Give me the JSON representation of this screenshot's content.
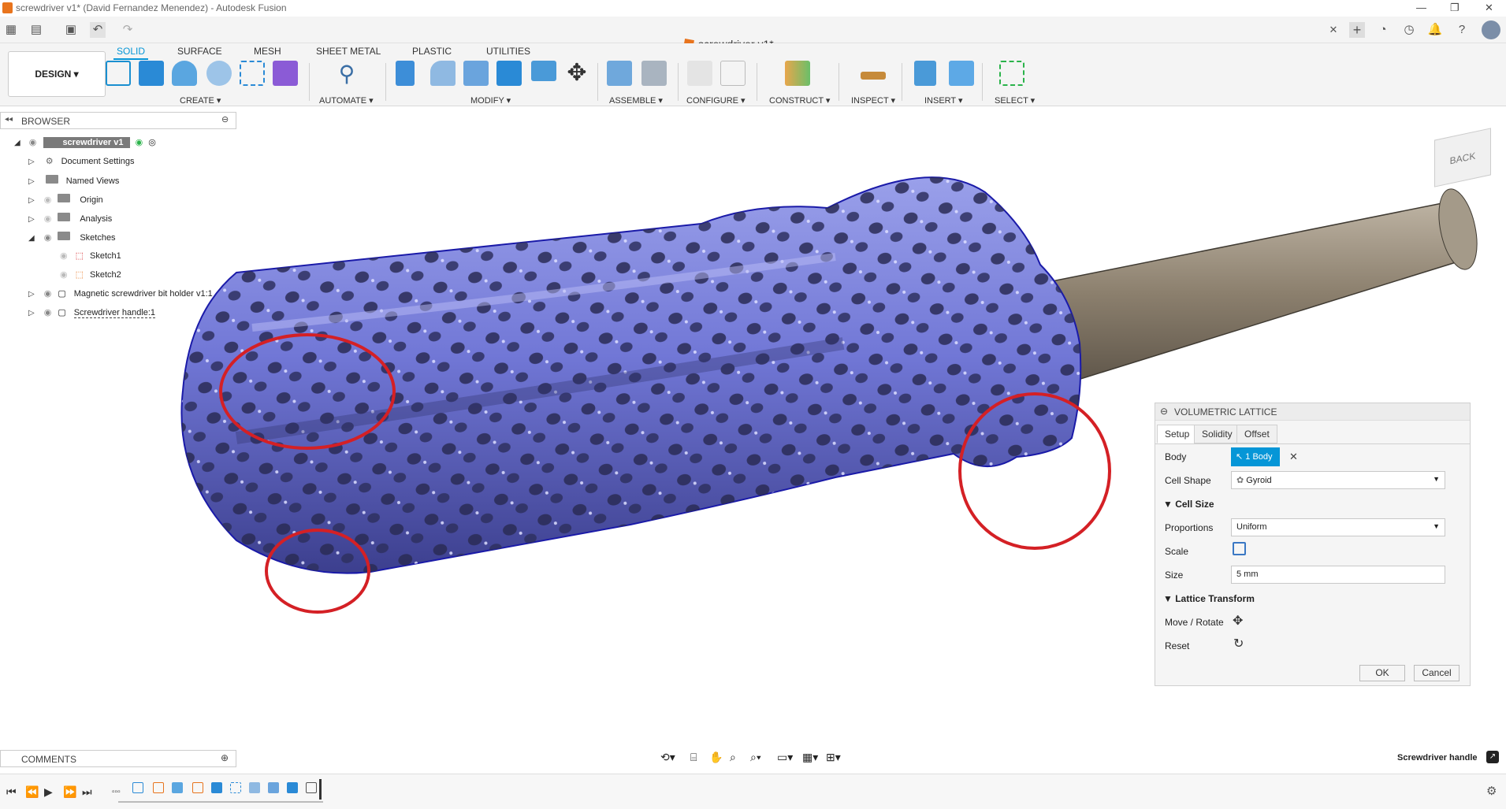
{
  "window": {
    "title": "screwdriver v1* (David Fernandez Menendez) - Autodesk Fusion",
    "document_tab": "screwdriver v1*"
  },
  "ribbon": {
    "workspace": "DESIGN",
    "tabs": [
      {
        "label": "SOLID",
        "active": true
      },
      {
        "label": "SURFACE"
      },
      {
        "label": "MESH"
      },
      {
        "label": "SHEET METAL"
      },
      {
        "label": "PLASTIC"
      },
      {
        "label": "UTILITIES"
      }
    ],
    "groups": [
      "CREATE",
      "AUTOMATE",
      "MODIFY",
      "ASSEMBLE",
      "CONFIGURE",
      "CONSTRUCT",
      "INSPECT",
      "INSERT",
      "SELECT"
    ]
  },
  "browser": {
    "title": "BROWSER",
    "root": "screwdriver v1",
    "items": [
      "Document Settings",
      "Named Views",
      "Origin",
      "Analysis",
      "Sketches",
      "Sketch1",
      "Sketch2",
      "Magnetic screwdriver bit holder v1:1",
      "Screwdriver handle:1"
    ]
  },
  "panel": {
    "title": "VOLUMETRIC LATTICE",
    "tabs": [
      "Setup",
      "Solidity",
      "Offset"
    ],
    "body_label": "Body",
    "body_value": "1 Body",
    "cell_shape_label": "Cell Shape",
    "cell_shape_value": "Gyroid",
    "cell_size_section": "Cell Size",
    "proportions_label": "Proportions",
    "proportions_value": "Uniform",
    "scale_label": "Scale",
    "size_label": "Size",
    "size_value": "5 mm",
    "transform_section": "Lattice Transform",
    "move_rotate_label": "Move / Rotate",
    "reset_label": "Reset",
    "ok": "OK",
    "cancel": "Cancel"
  },
  "viewcube": {
    "face": "BACK"
  },
  "comments": {
    "title": "COMMENTS"
  },
  "status": {
    "selection": "Screwdriver handle"
  },
  "colors": {
    "accent": "#0696d7",
    "body": "#7d82d8",
    "highlight": "#d42025"
  }
}
